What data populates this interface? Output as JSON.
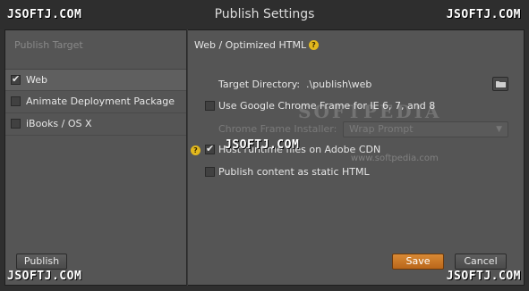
{
  "window": {
    "title": "Publish Settings"
  },
  "watermark": {
    "site": "JSOFTJ.COM",
    "softpedia": "SOFTPEDIA",
    "softpedia_url": "www.softpedia.com"
  },
  "left": {
    "header": "Publish Target",
    "targets": [
      {
        "label": "Web",
        "checked": true,
        "selected": true
      },
      {
        "label": "Animate Deployment Package",
        "checked": false,
        "selected": false
      },
      {
        "label": "iBooks / OS X",
        "checked": false,
        "selected": false
      }
    ],
    "publish_label": "Publish"
  },
  "right": {
    "section_title": "Web / Optimized HTML",
    "target_dir_label": "Target Directory:",
    "target_dir_value": ".\\publish\\web",
    "opt_chrome_frame": "Use Google Chrome Frame for IE 6, 7, and 8",
    "chrome_installer_label": "Chrome Frame Installer:",
    "chrome_installer_value": "Wrap Prompt",
    "opt_host_cdn": "Host runtime files on Adobe CDN",
    "opt_static_html": "Publish content as static HTML"
  },
  "footer": {
    "save_label": "Save",
    "cancel_label": "Cancel"
  },
  "colors": {
    "accent": "#c8741f",
    "help": "#e2b81d",
    "panel": "#555555"
  },
  "icons": [
    "check-icon",
    "help-icon",
    "folder-icon",
    "chevron-down-icon"
  ]
}
